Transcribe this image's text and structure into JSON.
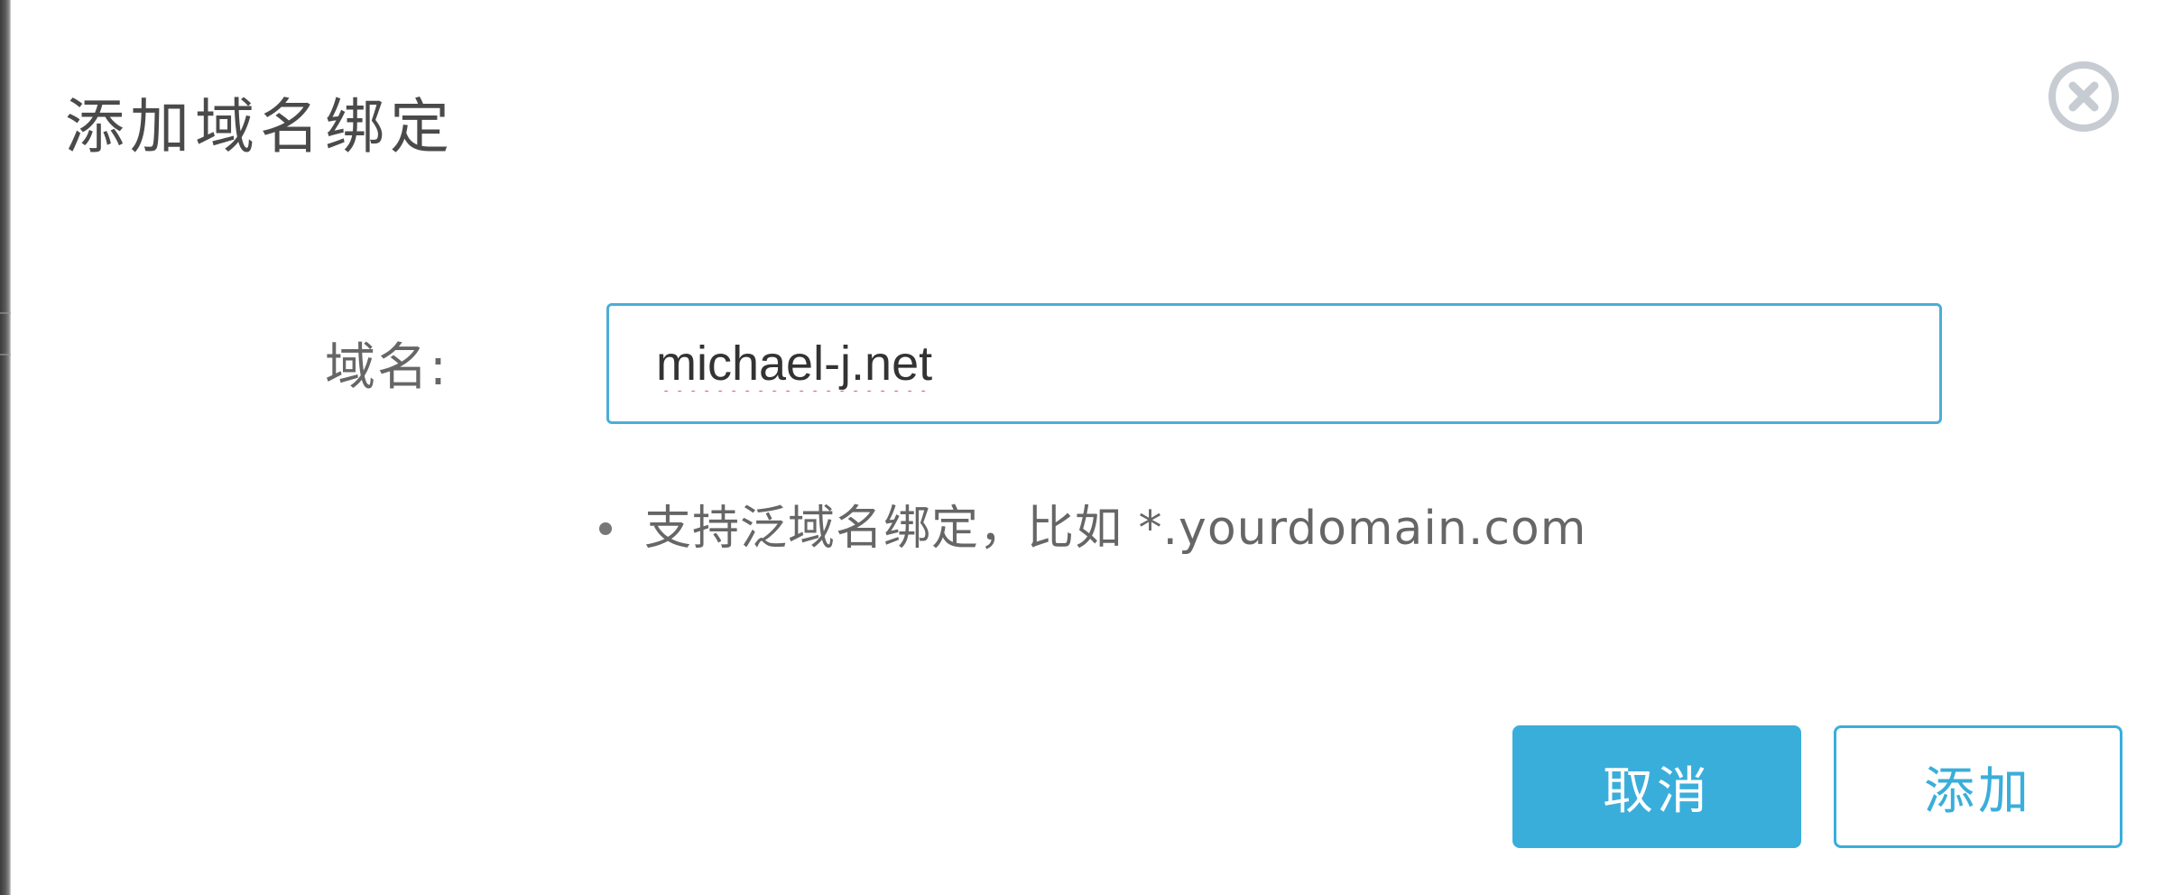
{
  "dialog": {
    "title": "添加域名绑定",
    "close_icon": "close-circle-icon"
  },
  "form": {
    "domain_label": "域名:",
    "domain_value": "michael-j.net",
    "hint": "支持泛域名绑定，比如 *.yourdomain.com"
  },
  "actions": {
    "cancel_label": "取消",
    "add_label": "添加"
  },
  "colors": {
    "accent": "#3aaedb",
    "input_border": "#4aaed8",
    "close_icon": "#c7ccd3",
    "spellcheck_underline": "#e0464a"
  }
}
